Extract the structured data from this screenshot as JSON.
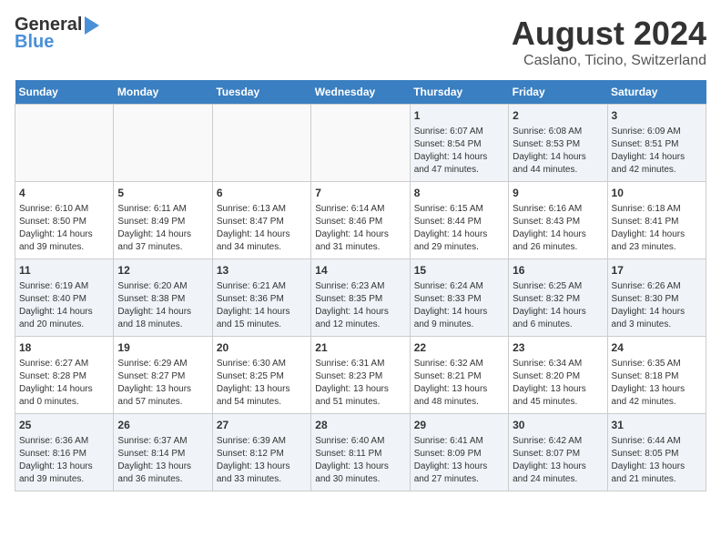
{
  "logo": {
    "line1": "General",
    "line2": "Blue"
  },
  "title": "August 2024",
  "subtitle": "Caslano, Ticino, Switzerland",
  "headers": [
    "Sunday",
    "Monday",
    "Tuesday",
    "Wednesday",
    "Thursday",
    "Friday",
    "Saturday"
  ],
  "weeks": [
    [
      {
        "day": "",
        "info": ""
      },
      {
        "day": "",
        "info": ""
      },
      {
        "day": "",
        "info": ""
      },
      {
        "day": "",
        "info": ""
      },
      {
        "day": "1",
        "info": "Sunrise: 6:07 AM\nSunset: 8:54 PM\nDaylight: 14 hours\nand 47 minutes."
      },
      {
        "day": "2",
        "info": "Sunrise: 6:08 AM\nSunset: 8:53 PM\nDaylight: 14 hours\nand 44 minutes."
      },
      {
        "day": "3",
        "info": "Sunrise: 6:09 AM\nSunset: 8:51 PM\nDaylight: 14 hours\nand 42 minutes."
      }
    ],
    [
      {
        "day": "4",
        "info": "Sunrise: 6:10 AM\nSunset: 8:50 PM\nDaylight: 14 hours\nand 39 minutes."
      },
      {
        "day": "5",
        "info": "Sunrise: 6:11 AM\nSunset: 8:49 PM\nDaylight: 14 hours\nand 37 minutes."
      },
      {
        "day": "6",
        "info": "Sunrise: 6:13 AM\nSunset: 8:47 PM\nDaylight: 14 hours\nand 34 minutes."
      },
      {
        "day": "7",
        "info": "Sunrise: 6:14 AM\nSunset: 8:46 PM\nDaylight: 14 hours\nand 31 minutes."
      },
      {
        "day": "8",
        "info": "Sunrise: 6:15 AM\nSunset: 8:44 PM\nDaylight: 14 hours\nand 29 minutes."
      },
      {
        "day": "9",
        "info": "Sunrise: 6:16 AM\nSunset: 8:43 PM\nDaylight: 14 hours\nand 26 minutes."
      },
      {
        "day": "10",
        "info": "Sunrise: 6:18 AM\nSunset: 8:41 PM\nDaylight: 14 hours\nand 23 minutes."
      }
    ],
    [
      {
        "day": "11",
        "info": "Sunrise: 6:19 AM\nSunset: 8:40 PM\nDaylight: 14 hours\nand 20 minutes."
      },
      {
        "day": "12",
        "info": "Sunrise: 6:20 AM\nSunset: 8:38 PM\nDaylight: 14 hours\nand 18 minutes."
      },
      {
        "day": "13",
        "info": "Sunrise: 6:21 AM\nSunset: 8:36 PM\nDaylight: 14 hours\nand 15 minutes."
      },
      {
        "day": "14",
        "info": "Sunrise: 6:23 AM\nSunset: 8:35 PM\nDaylight: 14 hours\nand 12 minutes."
      },
      {
        "day": "15",
        "info": "Sunrise: 6:24 AM\nSunset: 8:33 PM\nDaylight: 14 hours\nand 9 minutes."
      },
      {
        "day": "16",
        "info": "Sunrise: 6:25 AM\nSunset: 8:32 PM\nDaylight: 14 hours\nand 6 minutes."
      },
      {
        "day": "17",
        "info": "Sunrise: 6:26 AM\nSunset: 8:30 PM\nDaylight: 14 hours\nand 3 minutes."
      }
    ],
    [
      {
        "day": "18",
        "info": "Sunrise: 6:27 AM\nSunset: 8:28 PM\nDaylight: 14 hours\nand 0 minutes."
      },
      {
        "day": "19",
        "info": "Sunrise: 6:29 AM\nSunset: 8:27 PM\nDaylight: 13 hours\nand 57 minutes."
      },
      {
        "day": "20",
        "info": "Sunrise: 6:30 AM\nSunset: 8:25 PM\nDaylight: 13 hours\nand 54 minutes."
      },
      {
        "day": "21",
        "info": "Sunrise: 6:31 AM\nSunset: 8:23 PM\nDaylight: 13 hours\nand 51 minutes."
      },
      {
        "day": "22",
        "info": "Sunrise: 6:32 AM\nSunset: 8:21 PM\nDaylight: 13 hours\nand 48 minutes."
      },
      {
        "day": "23",
        "info": "Sunrise: 6:34 AM\nSunset: 8:20 PM\nDaylight: 13 hours\nand 45 minutes."
      },
      {
        "day": "24",
        "info": "Sunrise: 6:35 AM\nSunset: 8:18 PM\nDaylight: 13 hours\nand 42 minutes."
      }
    ],
    [
      {
        "day": "25",
        "info": "Sunrise: 6:36 AM\nSunset: 8:16 PM\nDaylight: 13 hours\nand 39 minutes."
      },
      {
        "day": "26",
        "info": "Sunrise: 6:37 AM\nSunset: 8:14 PM\nDaylight: 13 hours\nand 36 minutes."
      },
      {
        "day": "27",
        "info": "Sunrise: 6:39 AM\nSunset: 8:12 PM\nDaylight: 13 hours\nand 33 minutes."
      },
      {
        "day": "28",
        "info": "Sunrise: 6:40 AM\nSunset: 8:11 PM\nDaylight: 13 hours\nand 30 minutes."
      },
      {
        "day": "29",
        "info": "Sunrise: 6:41 AM\nSunset: 8:09 PM\nDaylight: 13 hours\nand 27 minutes."
      },
      {
        "day": "30",
        "info": "Sunrise: 6:42 AM\nSunset: 8:07 PM\nDaylight: 13 hours\nand 24 minutes."
      },
      {
        "day": "31",
        "info": "Sunrise: 6:44 AM\nSunset: 8:05 PM\nDaylight: 13 hours\nand 21 minutes."
      }
    ]
  ]
}
